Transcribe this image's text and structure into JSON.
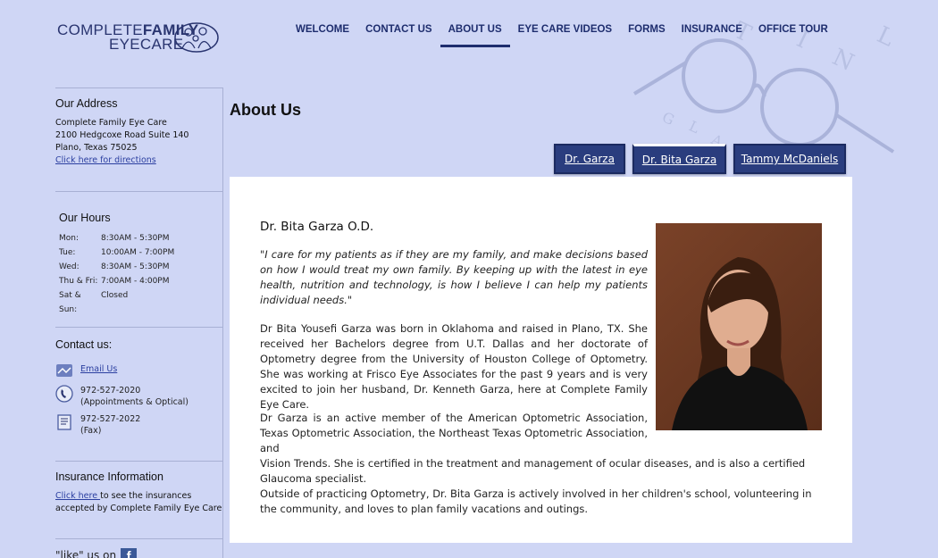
{
  "logo": {
    "line1_a": "COMPLETE",
    "line1_b": "FAMILY",
    "line2": "EYECARE"
  },
  "nav": [
    {
      "label": "WELCOME"
    },
    {
      "label": "CONTACT US"
    },
    {
      "label": "ABOUT US",
      "active": true
    },
    {
      "label": "EYE CARE VIDEOS"
    },
    {
      "label": "FORMS"
    },
    {
      "label": "INSURANCE"
    },
    {
      "label": "OFFICE TOUR"
    }
  ],
  "sidebar": {
    "address": {
      "title": "Our Address",
      "name": "Complete Family Eye Care",
      "street": "2100 Hedgcoxe Road Suite 140",
      "city": "Plano, Texas 75025",
      "directions_link": "Click here for directions"
    },
    "hours": {
      "title": "Our Hours",
      "rows": [
        {
          "day": "Mon:",
          "time": "8:30AM - 5:30PM"
        },
        {
          "day": "Tue:",
          "time": "10:00AM - 7:00PM"
        },
        {
          "day": "Wed:",
          "time": "8:30AM - 5:30PM"
        },
        {
          "day": "Thu & Fri:",
          "time": "7:00AM - 4:00PM"
        },
        {
          "day": "Sat & Sun:",
          "time": "Closed"
        }
      ]
    },
    "contact": {
      "title": "Contact us:",
      "email_link": "Email Us",
      "phone": "972-527-2020",
      "phone_note": "(Appointments & Optical)",
      "fax": "972-527-2022",
      "fax_note": "(Fax)"
    },
    "insurance": {
      "title": "Insurance Information",
      "link": "Click here ",
      "text": "to see the insurances accepted by Complete Family Eye Care"
    },
    "like": {
      "text": "\"like\" us on",
      "fb": "f"
    }
  },
  "main": {
    "title": "About Us",
    "tabs": [
      {
        "label": "Dr. Garza"
      },
      {
        "label": "Dr. Bita Garza",
        "active": true
      },
      {
        "label": "Tammy McDaniels"
      }
    ],
    "doctor_name": "Dr. Bita Garza O.D.",
    "quote": "\"I care for my patients as if they are my family, and make decisions based on how I would treat my own family. By keeping up with the latest in eye health, nutrition and technology, is how I believe I can help my patients individual needs.\"",
    "para1": "Dr Bita Yousefi Garza was born in Oklahoma and raised in Plano, TX. She received her Bachelors degree from U.T. Dallas and her doctorate of Optometry degree from the University of Houston College of Optometry. She was working at Frisco Eye Associates for the past 9 years and is very excited to join her husband, Dr. Kenneth Garza, here at Complete Family Eye Care.",
    "para2a": "Dr Garza is an active member of the American Optometric Association, Texas Optometric Association, the Northeast Texas Optometric Association, and",
    "para2b": "Vision Trends. She is certified in the treatment and management of ocular diseases, and is also a certified Glaucoma specialist.",
    "para3": "Outside of practicing Optometry, Dr. Bita Garza is actively involved in her children's school, volunteering in the community, and loves to plan family vacations and outings."
  },
  "colors": {
    "background": "#cfd6f5",
    "nav_text": "#1e2d6e",
    "tab_bg": "#2a3d7e",
    "link": "#2b3fa0"
  }
}
